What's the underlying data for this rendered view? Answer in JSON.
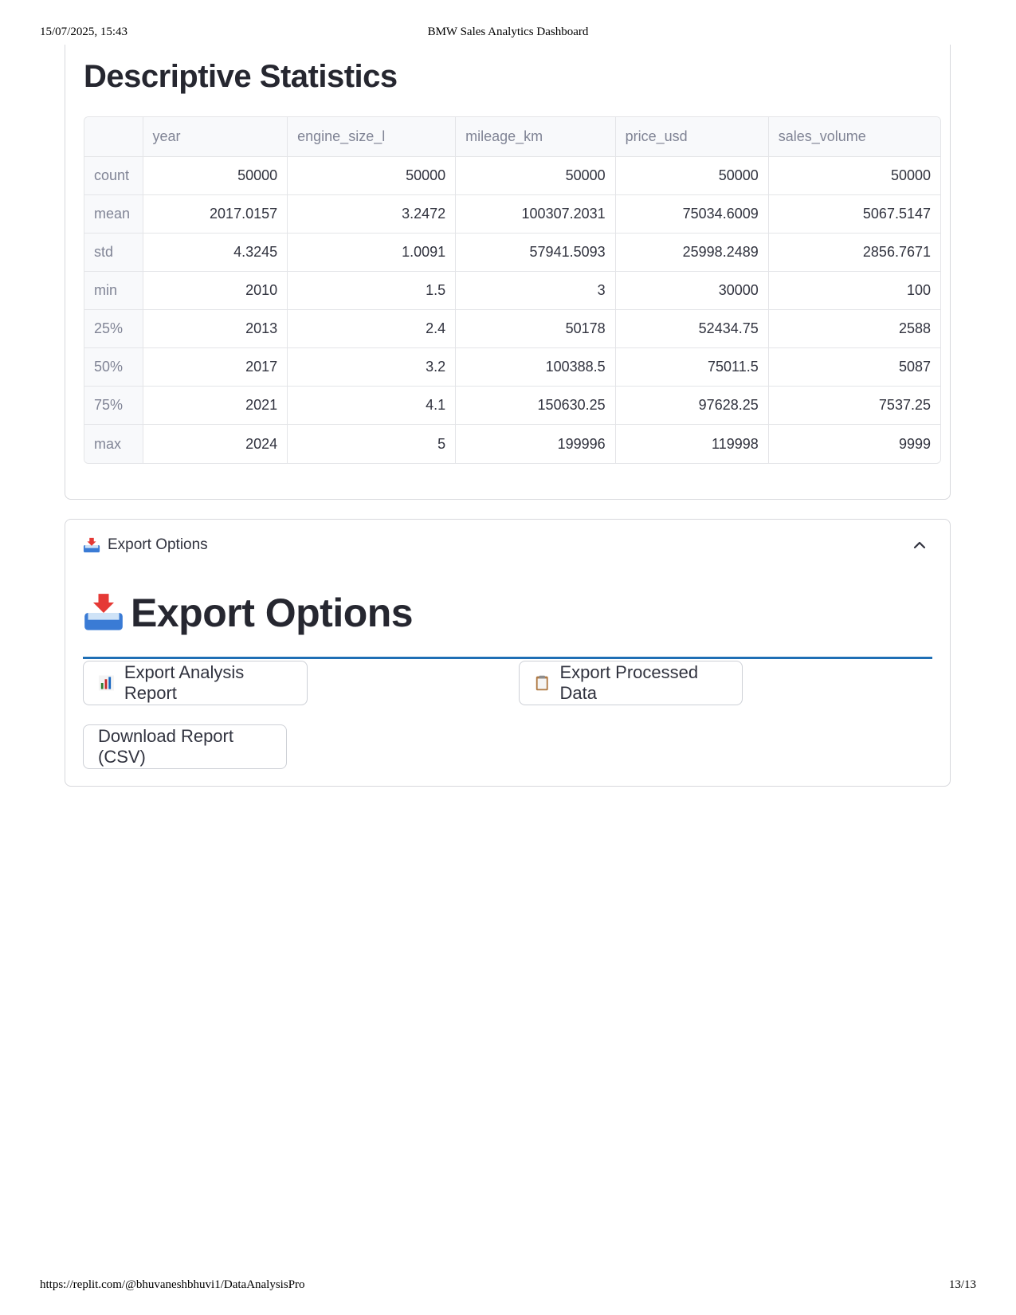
{
  "print": {
    "datetime": "15/07/2025, 15:43",
    "title": "BMW Sales Analytics Dashboard",
    "url": "https://replit.com/@bhuvaneshbhuvi1/DataAnalysisPro",
    "page": "13/13"
  },
  "stats": {
    "title": "Descriptive Statistics",
    "columns": [
      "",
      "year",
      "engine_size_l",
      "mileage_km",
      "price_usd",
      "sales_volume"
    ],
    "rows": [
      {
        "label": "count",
        "values": [
          "50000",
          "50000",
          "50000",
          "50000",
          "50000"
        ]
      },
      {
        "label": "mean",
        "values": [
          "2017.0157",
          "3.2472",
          "100307.2031",
          "75034.6009",
          "5067.5147"
        ]
      },
      {
        "label": "std",
        "values": [
          "4.3245",
          "1.0091",
          "57941.5093",
          "25998.2489",
          "2856.7671"
        ]
      },
      {
        "label": "min",
        "values": [
          "2010",
          "1.5",
          "3",
          "30000",
          "100"
        ]
      },
      {
        "label": "25%",
        "values": [
          "2013",
          "2.4",
          "50178",
          "52434.75",
          "2588"
        ]
      },
      {
        "label": "50%",
        "values": [
          "2017",
          "3.2",
          "100388.5",
          "75011.5",
          "5087"
        ]
      },
      {
        "label": "75%",
        "values": [
          "2021",
          "4.1",
          "150630.25",
          "97628.25",
          "7537.25"
        ]
      },
      {
        "label": "max",
        "values": [
          "2024",
          "5",
          "199996",
          "119998",
          "9999"
        ]
      }
    ]
  },
  "export": {
    "expander_label": "Export Options",
    "expander_icon": "inbox-tray-icon",
    "title": "Export Options",
    "accent_color": "#1f6fb5",
    "buttons": {
      "analysis_report": "Export Analysis Report",
      "processed_data": "Export Processed Data",
      "download_csv": "Download Report (CSV)"
    }
  }
}
